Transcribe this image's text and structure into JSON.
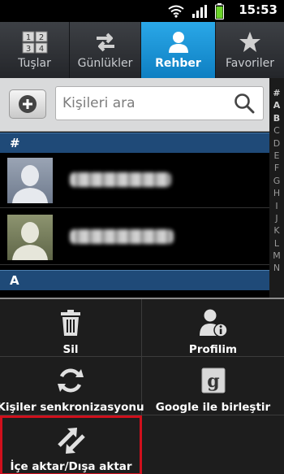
{
  "status_bar": {
    "time": "15:53",
    "icons": [
      "wifi-icon",
      "signal-icon",
      "battery-icon"
    ]
  },
  "tabs": [
    {
      "label": "Tuşlar",
      "icon": "dialpad-icon",
      "active": false
    },
    {
      "label": "Günlükler",
      "icon": "logs-icon",
      "active": false
    },
    {
      "label": "Rehber",
      "icon": "contacts-icon",
      "active": true
    },
    {
      "label": "Favoriler",
      "icon": "star-icon",
      "active": false
    }
  ],
  "dialpad_keys": [
    "12",
    "34"
  ],
  "search": {
    "placeholder": "Kişileri ara",
    "value": ""
  },
  "index_letters": [
    "#",
    "A",
    "B",
    "C",
    "D",
    "E",
    "F",
    "G",
    "H",
    "I",
    "J",
    "K",
    "L",
    "M",
    "N"
  ],
  "contact_sections": [
    {
      "header": "#"
    },
    {
      "header": "A"
    }
  ],
  "menu": {
    "items": [
      {
        "label": "Sil",
        "icon": "trash-icon"
      },
      {
        "label": "Profilim",
        "icon": "profile-info-icon"
      },
      {
        "label": "Kişiler senkronizasyonu",
        "icon": "sync-icon"
      },
      {
        "label": "Google ile birleştir",
        "icon": "google-icon"
      },
      {
        "label": "İçe aktar/Dışa aktar",
        "icon": "import-export-icon"
      }
    ]
  },
  "colors": {
    "accent": "#1a95d8",
    "section_header": "#1f4a78",
    "highlight_border": "#d0101c"
  }
}
